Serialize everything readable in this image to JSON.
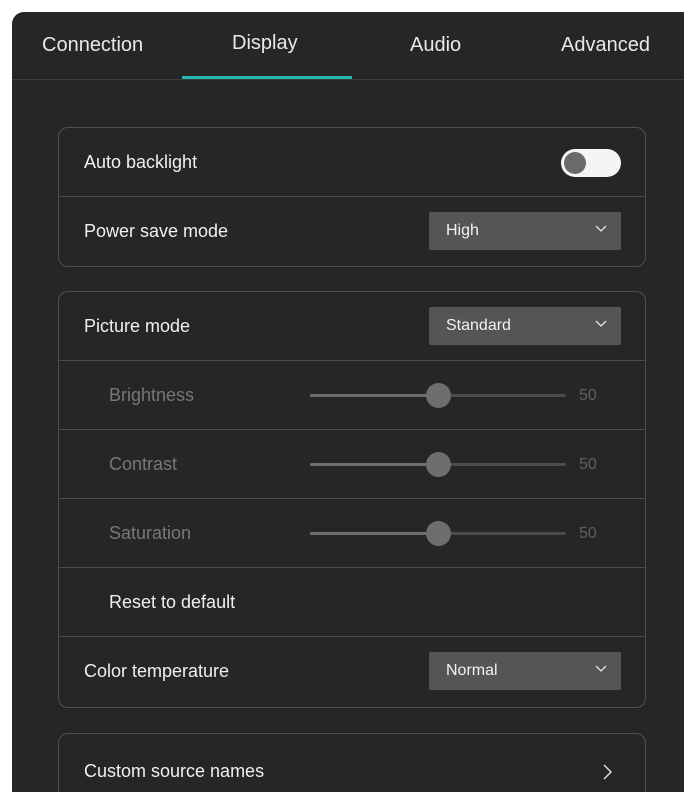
{
  "tabs": [
    {
      "label": "Connection",
      "active": false
    },
    {
      "label": "Display",
      "active": true
    },
    {
      "label": "Audio",
      "active": false
    },
    {
      "label": "Advanced",
      "active": false
    }
  ],
  "power_group": {
    "auto_backlight": {
      "label": "Auto backlight",
      "enabled": false
    },
    "power_save_mode": {
      "label": "Power save mode",
      "value": "High"
    }
  },
  "picture_group": {
    "picture_mode": {
      "label": "Picture mode",
      "value": "Standard"
    },
    "brightness": {
      "label": "Brightness",
      "value": "50",
      "level": 50
    },
    "contrast": {
      "label": "Contrast",
      "value": "50",
      "level": 50
    },
    "saturation": {
      "label": "Saturation",
      "value": "50",
      "level": 50
    },
    "reset": {
      "label": "Reset to default"
    },
    "color_temperature": {
      "label": "Color temperature",
      "value": "Normal"
    }
  },
  "source_group": {
    "custom_source_names": {
      "label": "Custom source names"
    }
  },
  "colors": {
    "accent": "#27b5b3",
    "background": "#262626",
    "select_bg": "#555555"
  }
}
